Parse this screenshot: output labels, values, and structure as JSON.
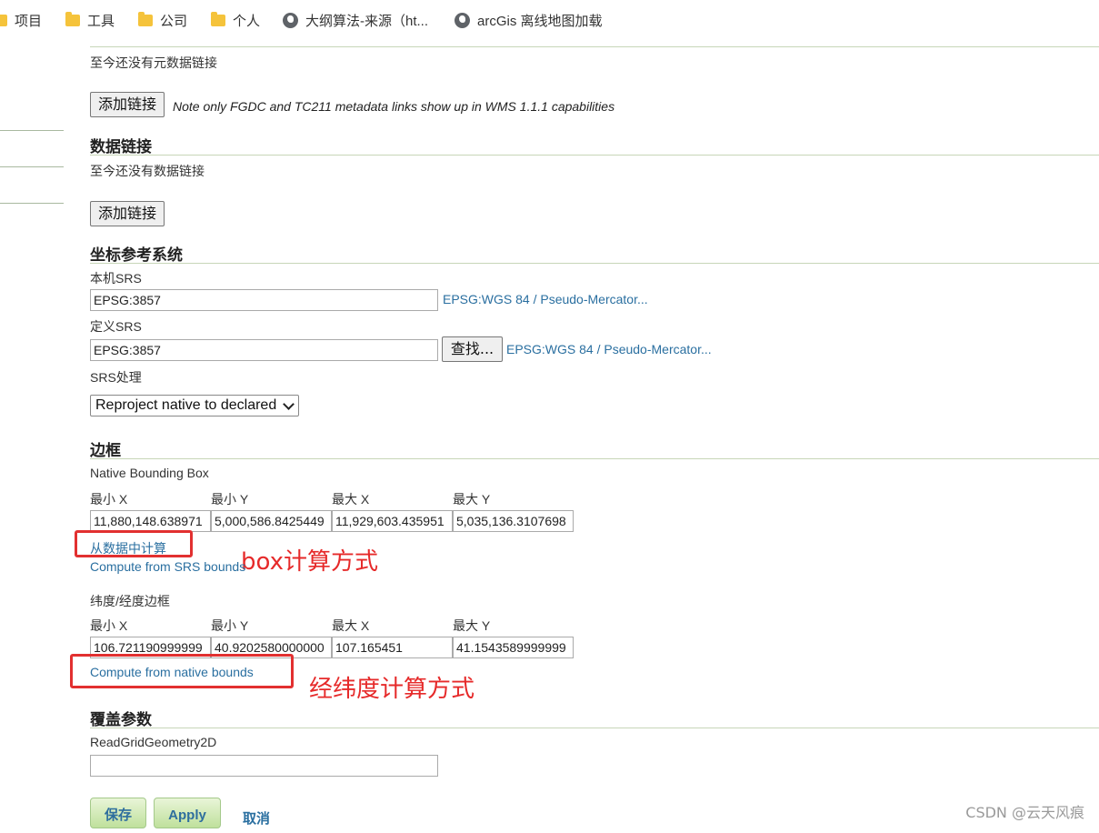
{
  "bookmarks": [
    {
      "label": "项目",
      "icon": "folder-icon"
    },
    {
      "label": "工具",
      "icon": "folder-icon"
    },
    {
      "label": "公司",
      "icon": "folder-icon"
    },
    {
      "label": "个人",
      "icon": "folder-icon"
    },
    {
      "label": "大纲算法-来源（ht...",
      "icon": "globe-icon"
    },
    {
      "label": "arcGis 离线地图加载",
      "icon": "globe-icon"
    }
  ],
  "metadata_links": {
    "empty_text": "至今还没有元数据链接",
    "add_button": "添加链接",
    "note": "Note only FGDC and TC211 metadata links show up in WMS 1.1.1 capabilities"
  },
  "data_links": {
    "title": "数据链接",
    "empty_text": "至今还没有数据链接",
    "add_button": "添加链接"
  },
  "crs": {
    "title": "坐标参考系统",
    "native_label": "本机SRS",
    "native_value": "EPSG:3857",
    "native_link": "EPSG:WGS 84 / Pseudo-Mercator...",
    "declared_label": "定义SRS",
    "declared_value": "EPSG:3857",
    "find_button": "查找...",
    "declared_link": "EPSG:WGS 84 / Pseudo-Mercator...",
    "handling_label": "SRS处理",
    "handling_value": "Reproject native to declared"
  },
  "bbox": {
    "title": "边框",
    "native_label": "Native Bounding Box",
    "native_headers": [
      "最小 X",
      "最小 Y",
      "最大 X",
      "最大 Y"
    ],
    "native_values": [
      "11,880,148.638971",
      "5,000,586.8425449",
      "11,929,603.435951",
      "5,035,136.3107698"
    ],
    "compute_from_data": "从数据中计算",
    "compute_from_srs": "Compute from SRS bounds",
    "latlon_label": "纬度/经度边框",
    "latlon_headers": [
      "最小 X",
      "最小 Y",
      "最大 X",
      "最大 Y"
    ],
    "latlon_values": [
      "106.721190999999",
      "40.9202580000000",
      "107.165451",
      "41.1543589999999"
    ],
    "compute_from_native": "Compute from native bounds"
  },
  "annotations": {
    "box_method": "box计算方式",
    "latlon_method": "经纬度计算方式"
  },
  "coverage": {
    "title": "覆盖参数",
    "param_label": "ReadGridGeometry2D",
    "param_value": ""
  },
  "actions": {
    "save": "保存",
    "apply": "Apply",
    "cancel": "取消"
  },
  "watermark": "CSDN @云天风痕"
}
